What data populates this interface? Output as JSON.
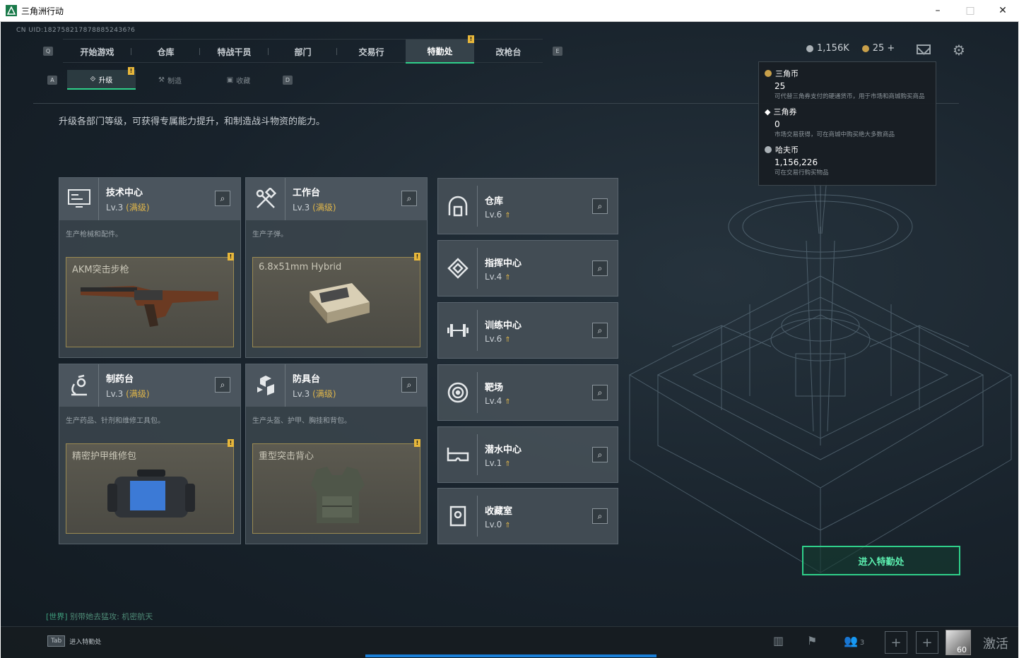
{
  "window": {
    "title": "三角洲行动",
    "minimize": "–",
    "maximize": "□",
    "close": "✕"
  },
  "uid": "CN UID:1827582178788852436?6",
  "topnav": {
    "key_left": "Q",
    "key_right": "E",
    "tabs": [
      {
        "label": "开始游戏"
      },
      {
        "label": "仓库"
      },
      {
        "label": "特战干员"
      },
      {
        "label": "部门"
      },
      {
        "label": "交易行"
      },
      {
        "label": "特勤处",
        "active": true,
        "badge": "!"
      },
      {
        "label": "改枪台"
      }
    ]
  },
  "currency": {
    "koala": "1,156K",
    "coupons": "25 +"
  },
  "subnav": {
    "key_left": "A",
    "key_right": "D",
    "tabs": [
      {
        "label": "升级",
        "active": true,
        "badge": "!"
      },
      {
        "label": "制造"
      },
      {
        "label": "收藏"
      }
    ]
  },
  "description": "升级各部门等级，可获得专属能力提升，和制造战斗物资的能力。",
  "big_cards": [
    {
      "name": "技术中心",
      "level": "Lv.3",
      "max": "(满级)",
      "desc": "生产枪械和配件。",
      "item": "AKM突击步枪",
      "badge": "!"
    },
    {
      "name": "工作台",
      "level": "Lv.3",
      "max": "(满级)",
      "desc": "生产子弹。",
      "item": "6.8x51mm Hybrid",
      "badge": "!"
    },
    {
      "name": "制药台",
      "level": "Lv.3",
      "max": "(满级)",
      "desc": "生产药品、针剂和维修工具包。",
      "item": "精密护甲维修包",
      "badge": "!"
    },
    {
      "name": "防具台",
      "level": "Lv.3",
      "max": "(满级)",
      "desc": "生产头盔、护甲、胸挂和背包。",
      "item": "重型突击背心",
      "badge": "!"
    }
  ],
  "small_cards": [
    {
      "name": "仓库",
      "level": "Lv.6"
    },
    {
      "name": "指挥中心",
      "level": "Lv.4"
    },
    {
      "name": "训练中心",
      "level": "Lv.6"
    },
    {
      "name": "靶场",
      "level": "Lv.4"
    },
    {
      "name": "潜水中心",
      "level": "Lv.1"
    },
    {
      "name": "收藏室",
      "level": "Lv.0"
    }
  ],
  "tooltip": [
    {
      "name": "三角币",
      "value": "25",
      "desc": "可代替三角券支付的硬通货币，用于市场和商城购买商品"
    },
    {
      "name": "三角券",
      "value": "0",
      "desc": "市场交易获得，可在商城中购买绝大多数商品"
    },
    {
      "name": "哈夫币",
      "value": "1,156,226",
      "desc": "可在交易行购买物品"
    }
  ],
  "enter_button": "进入特勤处",
  "chat": {
    "channel": "[世界]",
    "message": " 别带她去猛攻: 机密航天"
  },
  "bottom": {
    "tab_key": "Tab",
    "tab_label": "进入特勤处",
    "team_count": "3",
    "level": "60",
    "activate": "激活"
  },
  "colors": {
    "accent": "#2fd08a",
    "badge": "#e7b73b",
    "max_level": "#e0b64a"
  }
}
